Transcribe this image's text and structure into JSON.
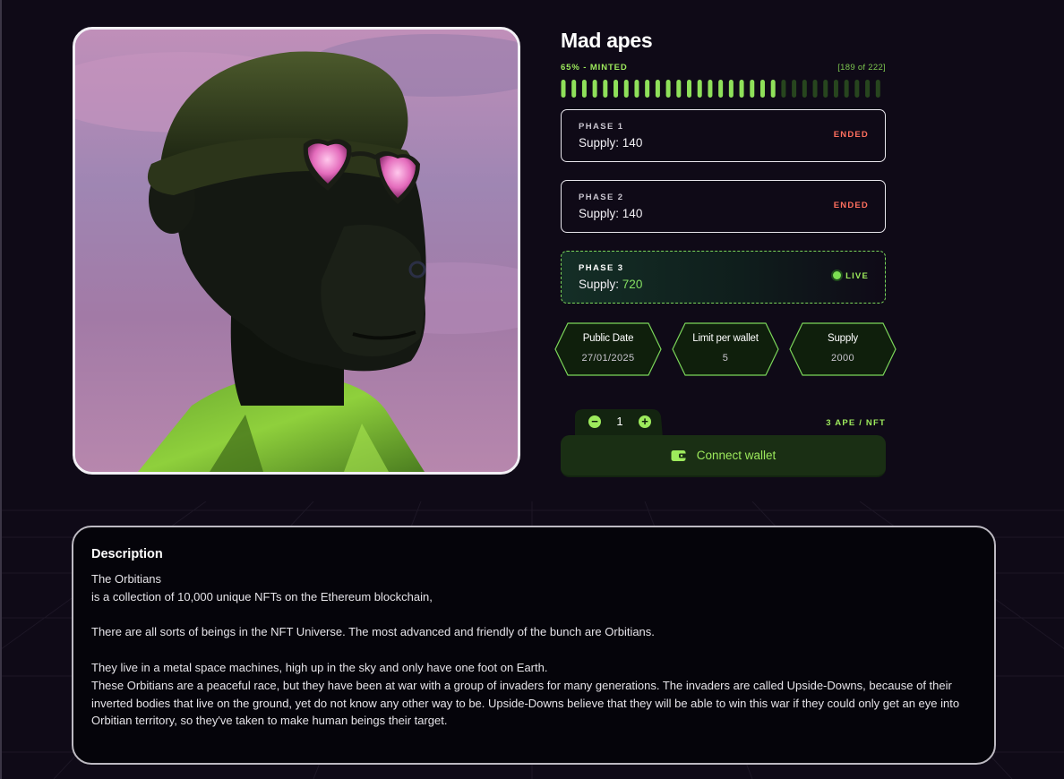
{
  "collection": {
    "title": "Mad apes",
    "image_alt": "3D ape with bucket hat and heart-shaped sunglasses in green jacket"
  },
  "mint": {
    "percent_label": "65% - MINTED",
    "count_label": "[189 of 222]",
    "filled_fraction": 0.65
  },
  "phases": [
    {
      "name": "PHASE 1",
      "supply_label": "Supply:",
      "supply_value": "140",
      "status": "ENDED"
    },
    {
      "name": "PHASE 2",
      "supply_label": "Supply:",
      "supply_value": "140",
      "status": "ENDED"
    },
    {
      "name": "PHASE 3",
      "supply_label": "Supply:",
      "supply_value": "720",
      "status": "LIVE"
    }
  ],
  "stats": [
    {
      "label": "Public Date",
      "value": "27/01/2025"
    },
    {
      "label": "Limit per wallet",
      "value": "5"
    },
    {
      "label": "Supply",
      "value": "2000"
    }
  ],
  "purchase": {
    "quantity": "1",
    "minus_symbol": "−",
    "plus_symbol": "+",
    "price_label": "3 APE / NFT",
    "connect_label": "Connect wallet"
  },
  "description": {
    "title": "Description",
    "line1": "The Orbitians",
    "line2": "is a collection of 10,000 unique NFTs on the Ethereum blockchain,",
    "para2": "There are all sorts of beings in the NFT Universe. The most advanced and friendly of the bunch are Orbitians.",
    "para3_line1": "They live in a metal space machines, high up in the sky and only have one foot on Earth.",
    "para3_line2": "These Orbitians are a peaceful race, but they have been at war with a group of invaders for many generations. The invaders are called Upside-Downs, because of their inverted bodies that live on the ground, yet do not know any other way to be. Upside-Downs believe that they will be able to win this war if they could only get an eye into Orbitian territory, so they've taken to make human beings their target."
  },
  "colors": {
    "background": "#0f0a17",
    "accent_green": "#9dea5c",
    "ended_red": "#ff6f5e",
    "panel_dark": "#05040a"
  },
  "icons": {
    "wallet": "wallet-icon",
    "live": "live-dot-icon",
    "minus": "minus-icon",
    "plus": "plus-icon"
  }
}
